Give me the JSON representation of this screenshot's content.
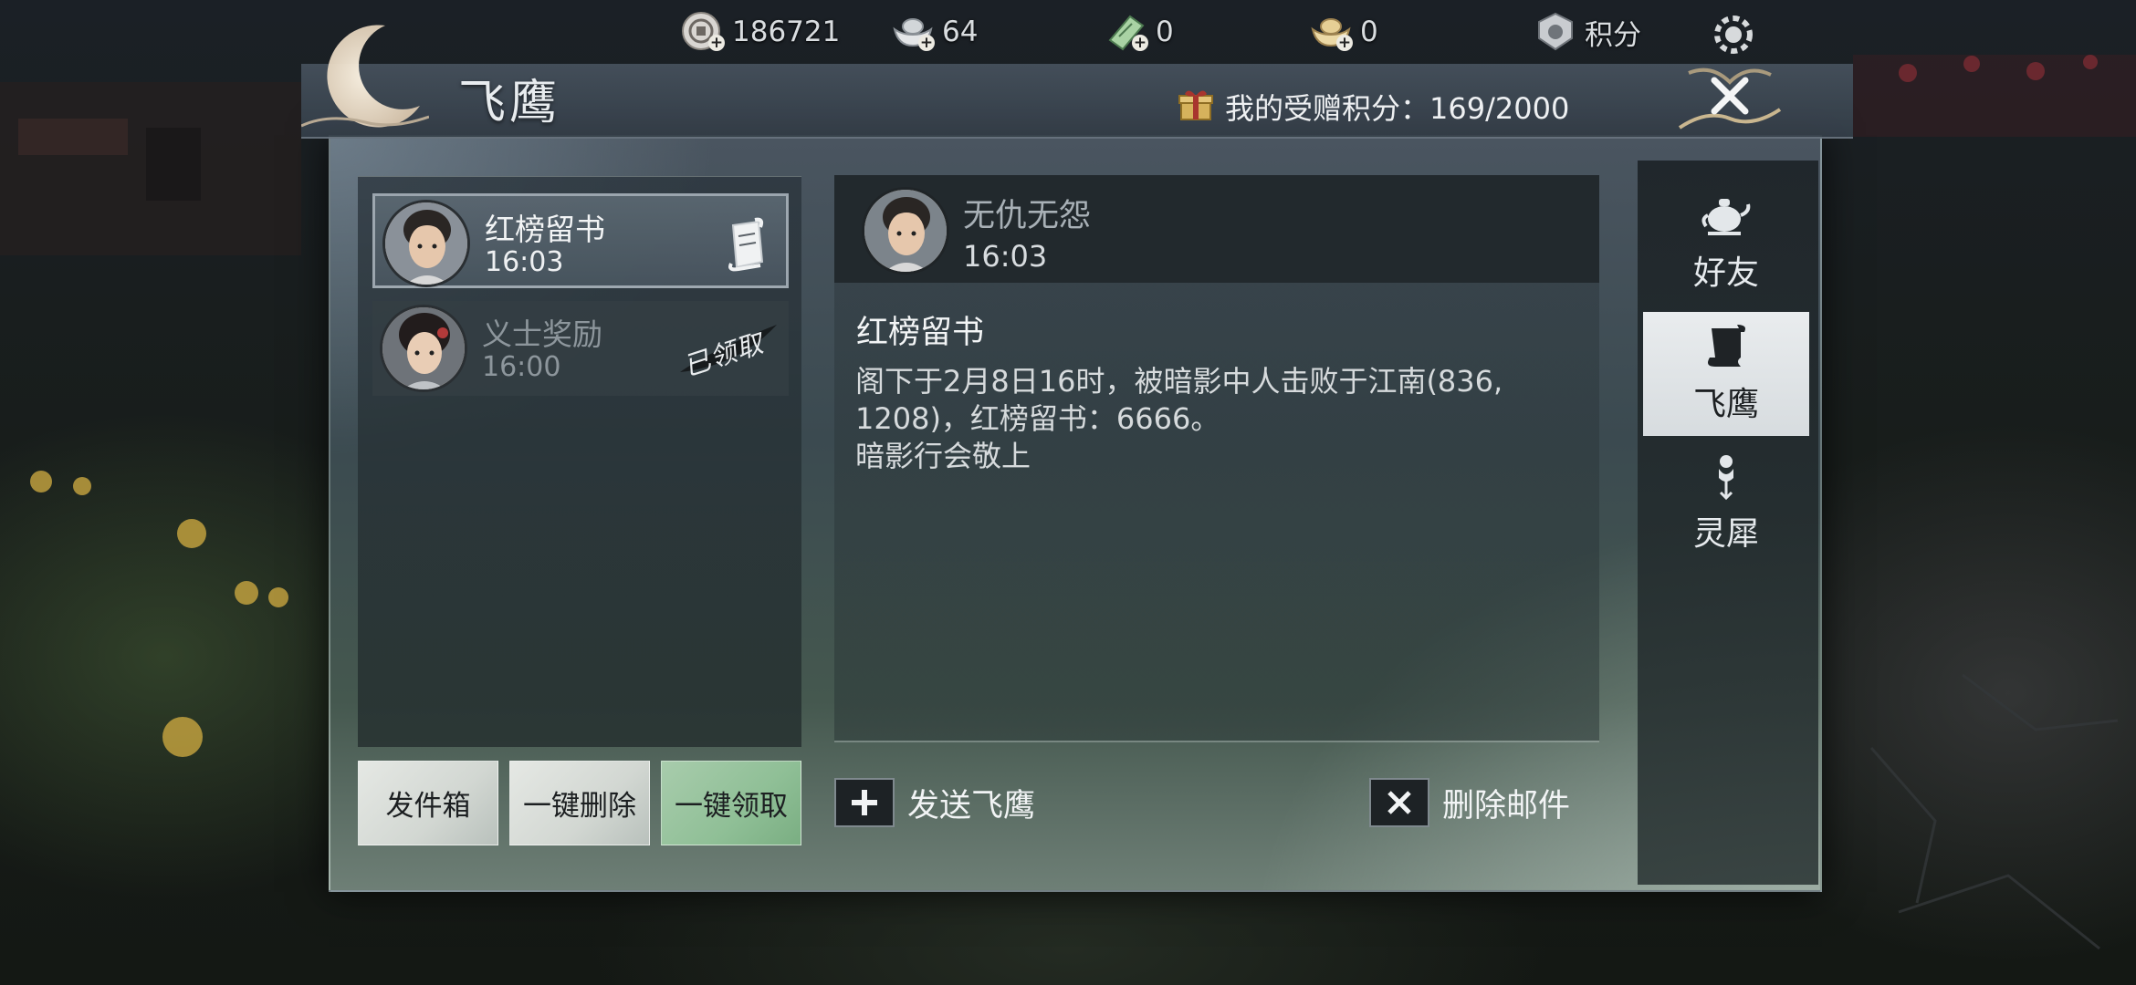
{
  "currency": [
    {
      "icon": "coin-icon",
      "value": "186721"
    },
    {
      "icon": "silver-ingot-icon",
      "value": "64"
    },
    {
      "icon": "jade-ticket-icon",
      "value": "0"
    },
    {
      "icon": "gold-ingot-icon",
      "value": "0"
    },
    {
      "icon": "points-badge-icon",
      "label": "积分"
    }
  ],
  "header": {
    "title": "飞鹰",
    "gift_points_label": "我的受赠积分：169/2000"
  },
  "mail_list": [
    {
      "name": "红榜留书",
      "time": "16:03",
      "state": "selected",
      "icon": "scroll-icon"
    },
    {
      "name": "义士奖励",
      "time": "16:00",
      "state": "claimed",
      "stamp": "已领取"
    }
  ],
  "list_buttons": {
    "outbox": "发件箱",
    "delete_all": "一键删除",
    "claim_all": "一键领取"
  },
  "detail": {
    "sender": "无仇无怨",
    "time": "16:03",
    "subject": "红榜留书",
    "body": [
      "阁下于2月8日16时，被暗影中人击败于江南(836,",
      "1208)，红榜留书：6666。",
      "暗影行会敬上"
    ]
  },
  "actions": {
    "send": "发送飞鹰",
    "delete": "删除邮件"
  },
  "tabs": [
    {
      "label": "好友",
      "icon": "teapot-icon",
      "active": false
    },
    {
      "label": "飞鹰",
      "icon": "scroll-icon",
      "active": true
    },
    {
      "label": "灵犀",
      "icon": "charm-icon",
      "active": false
    }
  ]
}
